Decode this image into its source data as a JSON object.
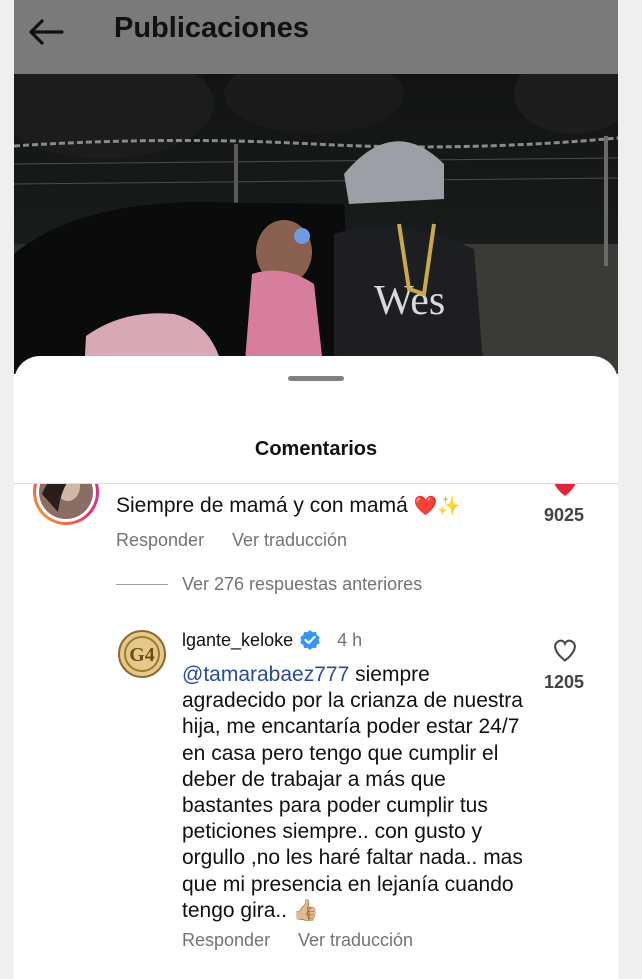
{
  "header": {
    "title": "Publicaciones",
    "back_icon": "arrow-left-icon"
  },
  "sheet": {
    "title": "Comentarios"
  },
  "comments": [
    {
      "text": "Siempre de mamá y con mamá",
      "emoji": "❤️✨",
      "likes": "9025",
      "reply_label": "Responder",
      "translate_label": "Ver traducción"
    }
  ],
  "replies_toggle": "Ver 276 respuestas anteriores",
  "reply": {
    "username": "lgante_keloke",
    "time": "4 h",
    "mention": "@tamarabaez777",
    "text": " siempre agradecido por la crianza de nuestra hija, me encantaría poder estar 24/7 en casa pero tengo que cumplir el deber de trabajar a más que bastantes para poder cumplir tus peticiones siempre.. con gusto y orgullo ,no les haré faltar nada.. mas que mi presencia en lejanía cuando tengo gira.. ",
    "emoji": "👍🏼",
    "likes": "1205",
    "reply_label": "Responder",
    "translate_label": "Ver traducción"
  },
  "colors": {
    "accent_heart": "#e0243b",
    "verified": "#3797f0",
    "mention": "#2a4a9b"
  }
}
